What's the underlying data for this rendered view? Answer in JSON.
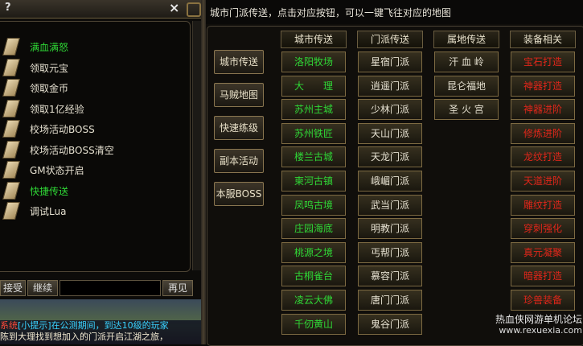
{
  "left_panel": {
    "header_glyph": "?",
    "close_glyph": "×",
    "items": [
      {
        "label": "满血满怒",
        "color": "#2fd836"
      },
      {
        "label": "领取元宝",
        "color": "#e5e0d0"
      },
      {
        "label": "领取金币",
        "color": "#e5e0d0"
      },
      {
        "label": "领取1亿经验",
        "color": "#e5e0d0"
      },
      {
        "label": "校场活动BOSS",
        "color": "#e5e0d0"
      },
      {
        "label": "校场活动BOSS清空",
        "color": "#e5e0d0"
      },
      {
        "label": "GM状态开启",
        "color": "#e5e0d0"
      },
      {
        "label": "快捷传送",
        "color": "#2fd836"
      },
      {
        "label": "调试Lua",
        "color": "#e5e0d0"
      }
    ],
    "buttons": {
      "accept": "接受",
      "continue": "继续",
      "again": "再见"
    },
    "chat": {
      "tag": "系统",
      "line1": "[小提示]在公测期间，到达10级的玩家",
      "line2": "陈到大理找到想加入的门派开启江湖之旅，"
    }
  },
  "right_panel": {
    "title": "城市门派传送，点击对应按钮，可以一键飞往对应的地图",
    "side_buttons": [
      "城市传送",
      "马贼地图",
      "快速练级",
      "副本活动",
      "本服BOSS"
    ],
    "columns": [
      {
        "header": "城市传送",
        "color": "#2fd836",
        "items": [
          "洛阳牧场",
          "大　　理",
          "苏州主城",
          "苏州铁匠",
          "楼兰古城",
          "柬河古镇",
          "凤鸣古境",
          "庄园海底",
          "桃源之境",
          "古桐雀台",
          "凌云大佛",
          "千仞黄山"
        ]
      },
      {
        "header": "门派传送",
        "color": "#e5e0d0",
        "items": [
          "星宿门派",
          "逍遥门派",
          "少林门派",
          "天山门派",
          "天龙门派",
          "峨嵋门派",
          "武当门派",
          "明教门派",
          "丐帮门派",
          "慕容门派",
          "唐门门派",
          "鬼谷门派"
        ]
      },
      {
        "header": "属地传送",
        "color": "#e5e0d0",
        "items": [
          "汗 血 岭",
          "昆仑福地",
          "圣 火 宫"
        ]
      },
      {
        "header": "装备相关",
        "color": "#e0261a",
        "items": [
          "宝石打造",
          "神器打造",
          "神器进阶",
          "修炼进阶",
          "龙纹打造",
          "天道进阶",
          "雕纹打造",
          "穿刺强化",
          "真元凝聚",
          "暗器打造",
          "珍兽装备"
        ]
      }
    ]
  },
  "watermark": {
    "line1": "热血侠网游单机论坛",
    "line2": "www.rexuexia.com"
  }
}
